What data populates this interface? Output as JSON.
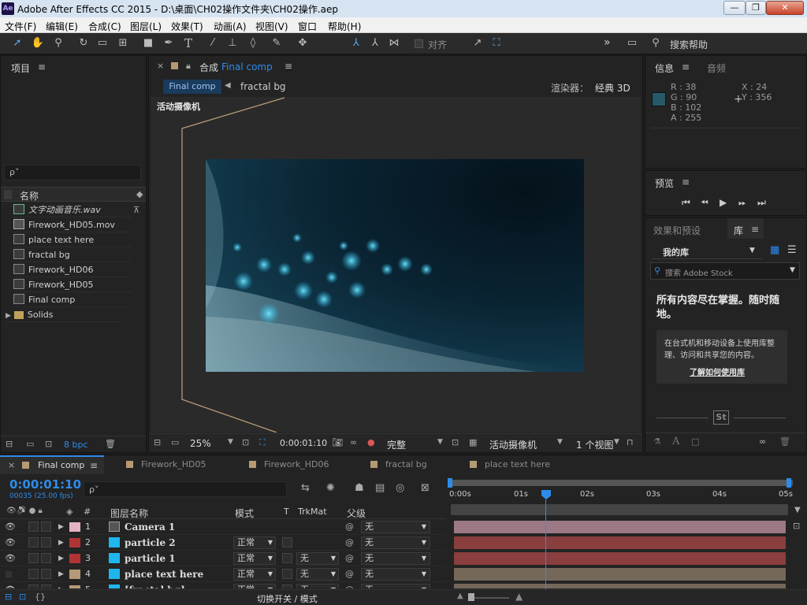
{
  "window": {
    "title": "Adobe After Effects CC 2015 - D:\\桌面\\CH02操作文件夹\\CH02操作.aep",
    "logo": "Ae",
    "minimize": "—",
    "restore": "❐",
    "close": "✕"
  },
  "menu": [
    "文件(F)",
    "编辑(E)",
    "合成(C)",
    "图层(L)",
    "效果(T)",
    "动画(A)",
    "视图(V)",
    "窗口",
    "帮助(H)"
  ],
  "toolbar": {
    "snap_label": "对齐",
    "search_help": "搜索帮助",
    "overflow": "»"
  },
  "project": {
    "title": "项目",
    "search_placeholder": "ρ˅",
    "col_name": "名称",
    "items": [
      {
        "name": "文字动画音乐.wav",
        "icon": "audio-file-icon"
      },
      {
        "name": "Firework_HD05.mov",
        "icon": "video-file-icon"
      },
      {
        "name": "place text here",
        "icon": "composition-icon"
      },
      {
        "name": "fractal bg",
        "icon": "composition-icon"
      },
      {
        "name": "Firework_HD06",
        "icon": "composition-icon"
      },
      {
        "name": "Firework_HD05",
        "icon": "composition-icon"
      },
      {
        "name": "Final comp",
        "icon": "composition-icon"
      },
      {
        "name": "Solids",
        "icon": "folder-icon"
      }
    ],
    "bpc": "8 bpc"
  },
  "comp": {
    "tab_prefix": "合成",
    "tab_name": "Final comp",
    "crumb_active": "Final comp",
    "crumb_next": "fractal bg",
    "renderer_label": "渲染器：",
    "renderer_value": "经典 3D",
    "camera_label": "活动摄像机",
    "zoom": "25%",
    "timecode": "0:00:01:10",
    "resolution": "完整",
    "view_camera": "活动摄像机",
    "views": "1 个视图"
  },
  "info": {
    "tab_info": "信息",
    "tab_audio": "音频",
    "r": "R : 38",
    "g": "G : 90",
    "b": "B : 102",
    "a": "A : 255",
    "x": "X : 24",
    "y": "Y : 356",
    "swatch": "#265a66"
  },
  "preview": {
    "title": "预览"
  },
  "library": {
    "tab_effects": "效果和预设",
    "tab_library": "库",
    "my_library": "我的库",
    "search_placeholder": "搜索 Adobe Stock",
    "headline": "所有内容尽在掌握。随时随地。",
    "body": "在台式机和移动设备上使用库整理、访问和共享您的内容。",
    "link": "了解如何使用库",
    "stock_badge": "St"
  },
  "timeline": {
    "active_tab": "Final comp",
    "other_tabs": [
      "Firework_HD05",
      "Firework_HD06",
      "fractal bg",
      "place text here"
    ],
    "timecode": "0:00:01:10",
    "fps": "00035 (25.00 fps)",
    "col_hash": "#",
    "col_layer_name": "图层名称",
    "col_mode": "模式",
    "col_t": "T",
    "col_trkmat": "TrkMat",
    "col_parent": "父级",
    "ruler": [
      "0:00s",
      "01s",
      "02s",
      "03s",
      "04s",
      "05s"
    ],
    "layers": [
      {
        "num": "1",
        "name": "Camera 1",
        "label": "#e2b3c0",
        "mode": "",
        "trkmat": "",
        "parent": "无",
        "bar": "#9c7984"
      },
      {
        "num": "2",
        "name": "particle 2",
        "label": "#b23333",
        "mode": "正常",
        "trkmat": "",
        "parent": "无",
        "bar": "#8a3e3e"
      },
      {
        "num": "3",
        "name": "particle 1",
        "label": "#b23333",
        "mode": "正常",
        "trkmat": "无",
        "parent": "无",
        "bar": "#8a3e3e"
      },
      {
        "num": "4",
        "name": "place text here",
        "label": "#b49a78",
        "mode": "正常",
        "trkmat": "无",
        "parent": "无",
        "bar": "#756859"
      },
      {
        "num": "5",
        "name": "[fractal bg]",
        "label": "#b49a78",
        "mode": "正常",
        "trkmat": "无",
        "parent": "无",
        "bar": "#756859"
      }
    ],
    "footer_toggle": "切换开关 / 模式",
    "current_time_fraction": 0.283
  },
  "colors": {
    "accent": "#2d8ceb",
    "panel_bg": "#232323",
    "timecode": "#2d8ceb"
  }
}
